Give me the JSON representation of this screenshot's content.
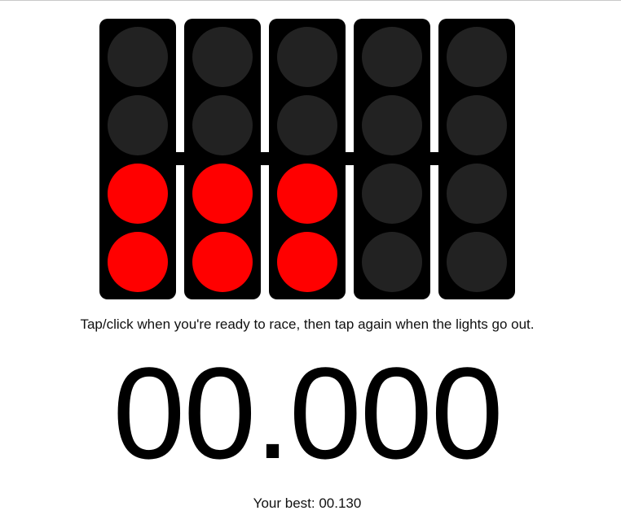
{
  "game": {
    "instructions": "Tap/click when you're ready to race, then tap again when the lights go out.",
    "timer": "00.000",
    "best_label": "Your best: 00.130"
  },
  "lights": [
    {
      "lamps": [
        "off",
        "off",
        "on",
        "on"
      ]
    },
    {
      "lamps": [
        "off",
        "off",
        "on",
        "on"
      ]
    },
    {
      "lamps": [
        "off",
        "off",
        "on",
        "on"
      ]
    },
    {
      "lamps": [
        "off",
        "off",
        "off",
        "off"
      ]
    },
    {
      "lamps": [
        "off",
        "off",
        "off",
        "off"
      ]
    }
  ],
  "colors": {
    "lamp_on": "#ff0000",
    "lamp_off": "#222222",
    "housing": "#000000"
  }
}
